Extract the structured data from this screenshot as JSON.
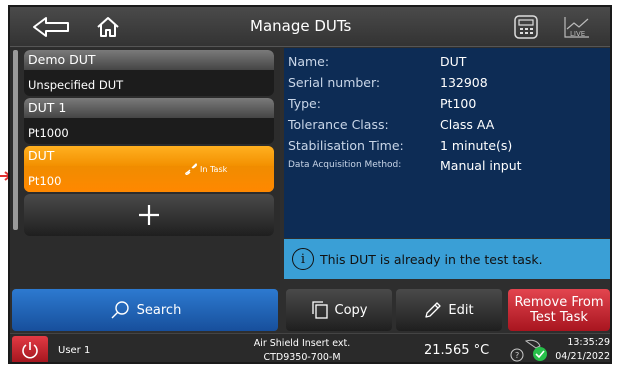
{
  "header": {
    "title": "Manage DUTs"
  },
  "dut_list": [
    {
      "name": "Demo DUT",
      "subtitle": "Unspecified DUT",
      "selected": false
    },
    {
      "name": "DUT 1",
      "subtitle": "Pt1000",
      "selected": false
    },
    {
      "name": "DUT",
      "subtitle": "Pt100",
      "selected": true,
      "badge": "In Task"
    }
  ],
  "details": {
    "name_label": "Name:",
    "name_value": "DUT",
    "serial_label": "Serial number:",
    "serial_value": "132908",
    "type_label": "Type:",
    "type_value": "Pt100",
    "tolerance_label": "Tolerance Class:",
    "tolerance_value": "Class AA",
    "stabilisation_label": "Stabilisation Time:",
    "stabilisation_value": "1 minute(s)",
    "acquisition_label": "Data Acquisition Method:",
    "acquisition_value": "Manual input"
  },
  "info": {
    "message": "This DUT is already in the test task."
  },
  "actions": {
    "search": "Search",
    "copy": "Copy",
    "edit": "Edit",
    "remove_line1": "Remove From",
    "remove_line2": "Test Task"
  },
  "status": {
    "user": "User 1",
    "sensor_line1": "Air Shield Insert ext.",
    "sensor_line2": "CTD9350-700-M",
    "temperature": "21.565 °C",
    "time": "13:35:29",
    "date": "04/21/2022"
  },
  "colors": {
    "selected_item": "#f29200",
    "detail_bg": "#0d2c55",
    "info_bg": "#3a9fd6",
    "search_bg": "#1f64b8",
    "remove_bg": "#c6202a",
    "status_ok": "#27c04a"
  },
  "icons": {
    "back": "back-arrow-icon",
    "home": "home-icon",
    "calc": "calculator-icon",
    "live": "live-chart-icon",
    "add": "plus-icon",
    "link": "link-icon",
    "info": "info-icon",
    "search": "search-icon",
    "copy": "copy-icon",
    "edit": "pencil-icon",
    "power": "power-icon",
    "status": "device-status-icon"
  }
}
